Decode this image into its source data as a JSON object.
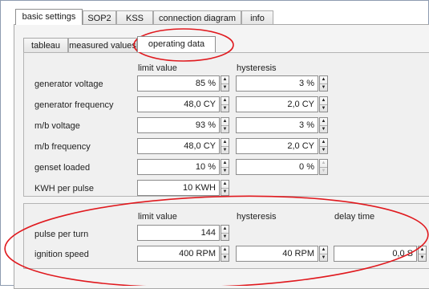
{
  "main_tabs": [
    {
      "label": "basic settings",
      "active": true
    },
    {
      "label": "SOP2",
      "active": false
    },
    {
      "label": "KSS",
      "active": false
    },
    {
      "label": "connection diagram",
      "active": false
    },
    {
      "label": "info",
      "active": false
    }
  ],
  "sub_tabs": [
    {
      "label": "tableau",
      "active": false
    },
    {
      "label": "measured values",
      "active": false
    },
    {
      "label": "operating data",
      "active": true
    }
  ],
  "top_section": {
    "col_limit": "limit value",
    "col_hysteresis": "hysteresis",
    "rows": [
      {
        "label": "generator voltage",
        "limit": "85 %",
        "hysteresis": "3 %"
      },
      {
        "label": "generator frequency",
        "limit": "48,0 CY",
        "hysteresis": "2,0 CY"
      },
      {
        "label": "m/b voltage",
        "limit": "93 %",
        "hysteresis": "3 %"
      },
      {
        "label": "m/b frequency",
        "limit": "48,0 CY",
        "hysteresis": "2,0 CY"
      },
      {
        "label": "genset loaded",
        "limit": "10 %",
        "hysteresis": "0 %"
      },
      {
        "label": "KWH per pulse",
        "limit": "10 KWH"
      }
    ]
  },
  "bottom_section": {
    "col_limit": "limit value",
    "col_hysteresis": "hysteresis",
    "col_delay": "delay time",
    "rows": [
      {
        "label": "pulse per turn",
        "limit": "144"
      },
      {
        "label": "ignition speed",
        "limit": "400 RPM",
        "hysteresis": "40 RPM",
        "delay": "0,0 S"
      }
    ]
  },
  "colors": {
    "annotation": "#e0191e",
    "tab_border": "#a9a9a9",
    "panel_bg": "#f0f0f0"
  }
}
